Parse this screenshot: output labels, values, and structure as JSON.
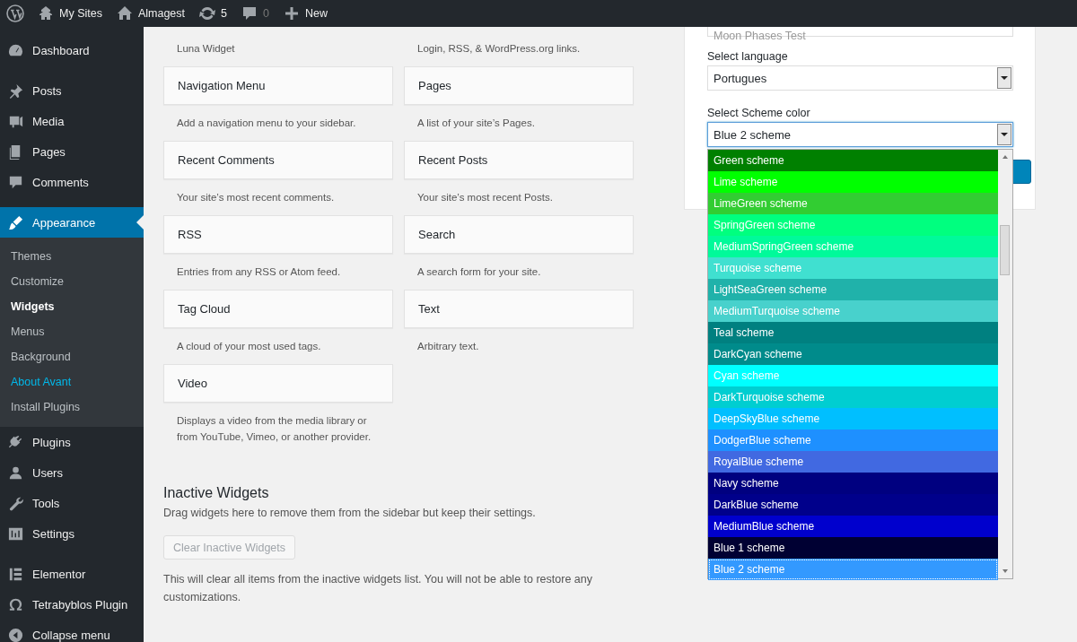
{
  "topbar": {
    "items": [
      {
        "kind": "logo"
      },
      {
        "kind": "sites",
        "label": "My Sites"
      },
      {
        "kind": "home",
        "label": "Almagest"
      },
      {
        "kind": "updates",
        "label": "5"
      },
      {
        "kind": "comments",
        "label": "0"
      },
      {
        "kind": "new",
        "label": "New"
      }
    ]
  },
  "sidebar": {
    "groups": [
      [
        {
          "kind": "dashboard",
          "label": "Dashboard",
          "selected": false
        }
      ],
      [
        {
          "kind": "pin",
          "label": "Posts",
          "selected": false
        },
        {
          "kind": "media",
          "label": "Media",
          "selected": false
        },
        {
          "kind": "pages",
          "label": "Pages",
          "selected": false
        },
        {
          "kind": "comment",
          "label": "Comments",
          "selected": false
        }
      ],
      [
        {
          "kind": "brush",
          "label": "Appearance",
          "selected": true,
          "children": [
            {
              "label": "Themes",
              "selected": false,
              "highlighted": false
            },
            {
              "label": "Customize",
              "selected": false,
              "highlighted": false
            },
            {
              "label": "Widgets",
              "selected": true,
              "highlighted": false
            },
            {
              "label": "Menus",
              "selected": false,
              "highlighted": false
            },
            {
              "label": "Background",
              "selected": false,
              "highlighted": false
            },
            {
              "label": "About Avant",
              "selected": false,
              "highlighted": true
            },
            {
              "label": "Install Plugins",
              "selected": false,
              "highlighted": false
            }
          ]
        },
        {
          "kind": "plug",
          "label": "Plugins",
          "selected": false
        },
        {
          "kind": "user",
          "label": "Users",
          "selected": false
        },
        {
          "kind": "wrench",
          "label": "Tools",
          "selected": false
        },
        {
          "kind": "sliders",
          "label": "Settings",
          "selected": false
        }
      ],
      [
        {
          "kind": "elementor",
          "label": "Elementor",
          "selected": false
        },
        {
          "kind": "omega",
          "label": "Tetrabyblos Plugin",
          "selected": false
        },
        {
          "kind": "collapse",
          "label": "Collapse menu",
          "selected": false
        }
      ]
    ]
  },
  "widgets": {
    "columns": [
      [
        {
          "description": "Luna Widget"
        },
        {
          "title": "Navigation Menu",
          "description": "Add a navigation menu to your sidebar."
        },
        {
          "title": "Recent Comments",
          "description": "Your site’s most recent comments."
        },
        {
          "title": "RSS",
          "description": "Entries from any RSS or Atom feed."
        },
        {
          "title": "Tag Cloud",
          "description": "A cloud of your most used tags."
        },
        {
          "title": "Video",
          "description": "Displays a video from the media library or from YouTube, Vimeo, or another provider."
        }
      ],
      [
        {
          "description": "Login, RSS, & WordPress.org links."
        },
        {
          "title": "Pages",
          "description": "A list of your site’s Pages."
        },
        {
          "title": "Recent Posts",
          "description": "Your site’s most recent Posts."
        },
        {
          "title": "Search",
          "description": "A search form for your site."
        },
        {
          "title": "Text",
          "description": "Arbitrary text."
        }
      ]
    ]
  },
  "inactive": {
    "heading": "Inactive Widgets",
    "description": "Drag widgets here to remove them from the sidebar but keep their settings.",
    "button": "Clear Inactive Widgets",
    "note": "This will clear all items from the inactive widgets list. You will not be able to restore any customizations."
  },
  "settings_panel": {
    "title_value": "Moon Phases Test",
    "language": {
      "label": "Select language",
      "value": "Portugues"
    },
    "scheme": {
      "label": "Select Scheme color",
      "value": "Blue 2 scheme",
      "expanded": true,
      "options": [
        {
          "label": "Green scheme",
          "color": "#008000",
          "selected": false
        },
        {
          "label": "Lime scheme",
          "color": "#00ff00",
          "selected": false
        },
        {
          "label": "LimeGreen scheme",
          "color": "#32cd32",
          "selected": false
        },
        {
          "label": "SpringGreen scheme",
          "color": "#00ff7f",
          "selected": false
        },
        {
          "label": "MediumSpringGreen scheme",
          "color": "#00fa9a",
          "selected": false
        },
        {
          "label": "Turquoise scheme",
          "color": "#40e0d0",
          "selected": false
        },
        {
          "label": "LightSeaGreen scheme",
          "color": "#20b2aa",
          "selected": false
        },
        {
          "label": "MediumTurquoise scheme",
          "color": "#48d1cc",
          "selected": false
        },
        {
          "label": "Teal scheme",
          "color": "#008080",
          "selected": false
        },
        {
          "label": "DarkCyan scheme",
          "color": "#008b8b",
          "selected": false
        },
        {
          "label": "Cyan scheme",
          "color": "#00ffff",
          "selected": false
        },
        {
          "label": "DarkTurquoise scheme",
          "color": "#00ced1",
          "selected": false
        },
        {
          "label": "DeepSkyBlue scheme",
          "color": "#00bfff",
          "selected": false
        },
        {
          "label": "DodgerBlue scheme",
          "color": "#1e90ff",
          "selected": false
        },
        {
          "label": "RoyalBlue scheme",
          "color": "#4169e1",
          "selected": false
        },
        {
          "label": "Navy scheme",
          "color": "#000080",
          "selected": false
        },
        {
          "label": "DarkBlue scheme",
          "color": "#00008b",
          "selected": false
        },
        {
          "label": "MediumBlue scheme",
          "color": "#0000cd",
          "selected": false
        },
        {
          "label": "Blue 1 scheme",
          "color": "#000033",
          "selected": false
        },
        {
          "label": "Blue 2 scheme",
          "color": "#3399ff",
          "selected": true
        }
      ]
    }
  }
}
